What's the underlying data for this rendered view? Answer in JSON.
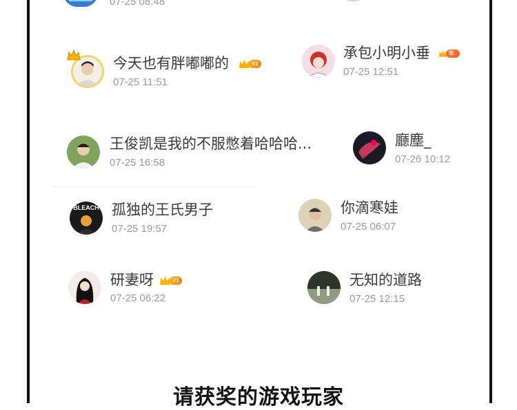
{
  "top_partial": {
    "time": "07-25 08:48"
  },
  "winners": [
    {
      "name": "今天也有胖嘟嘟的",
      "time": "07-25 11:51",
      "badge": "V2"
    },
    {
      "name": "承包小明小垂",
      "time": "07-25 12:51",
      "badge": "年费"
    },
    {
      "name": "王俊凯是我的不服憋着哈哈哈...",
      "time": "07-25 16:58"
    },
    {
      "name": "廳塵_",
      "time": "07-26 10:12"
    },
    {
      "name": "孤独的王氏男子",
      "time": "07-25 19:57",
      "avatar_text": "BLEACH"
    },
    {
      "name": "你滴寒娃",
      "time": "07-25 06:07"
    },
    {
      "name": "研妻呀",
      "time": "07-25 06:22",
      "badge": "V1"
    },
    {
      "name": "无知的道路",
      "time": "07-25 12:15"
    }
  ],
  "footer": {
    "title": "请获奖的游戏玩家"
  },
  "colors": {
    "border": "#111111",
    "name": "#3a3a3a",
    "time": "#9a9a9a",
    "vip_gold": "#ffb300",
    "vip_orange": "#ff7a1a"
  }
}
